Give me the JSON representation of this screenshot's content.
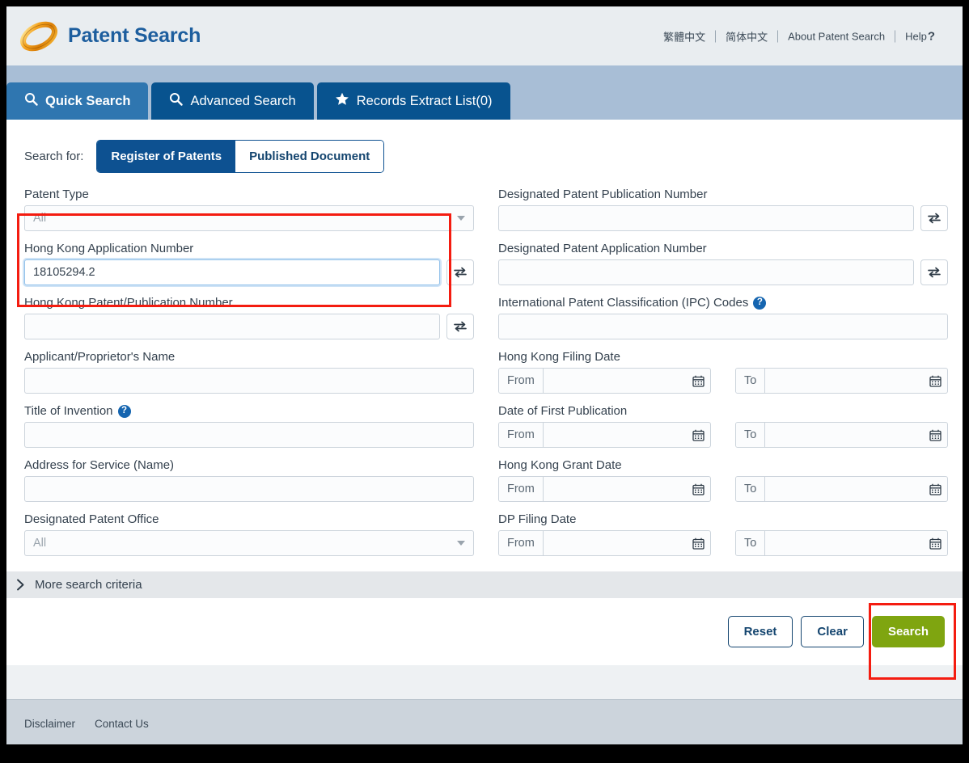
{
  "header": {
    "brand": "Patent Search",
    "logo_icon": "patent-ring-logo",
    "links": [
      {
        "label": "繁體中文",
        "name": "lang-traditional-chinese"
      },
      {
        "label": "简体中文",
        "name": "lang-simplified-chinese"
      },
      {
        "label": "About Patent Search",
        "name": "about-patent-search"
      },
      {
        "label": "Help",
        "name": "help"
      }
    ],
    "help_suffix": "?"
  },
  "tabs": [
    {
      "label": "Quick Search",
      "icon": "magnifier-icon",
      "active": true
    },
    {
      "label": "Advanced Search",
      "icon": "magnifier-icon",
      "active": false
    },
    {
      "label": "Records Extract List(0)",
      "icon": "star-icon",
      "active": false
    }
  ],
  "search_for": {
    "label": "Search for:",
    "options": [
      {
        "label": "Register of Patents",
        "selected": true
      },
      {
        "label": "Published Document",
        "selected": false
      }
    ]
  },
  "left_column": {
    "patent_type": {
      "label": "Patent Type",
      "value": "All",
      "placeholder": "All"
    },
    "hk_application_number": {
      "label": "Hong Kong Application Number",
      "value": "18105294.2",
      "placeholder": "",
      "swap_icon": "swap-arrows-icon",
      "highlighted": true
    },
    "hk_patent_publication_number": {
      "label": "Hong Kong Patent/Publication Number",
      "value": "",
      "placeholder": "",
      "swap_icon": "swap-arrows-icon"
    },
    "applicant_name": {
      "label": "Applicant/Proprietor's Name",
      "value": "",
      "placeholder": ""
    },
    "title_of_invention": {
      "label": "Title of Invention",
      "value": "",
      "placeholder": "",
      "help_icon": "question-mark-icon"
    },
    "address_for_service": {
      "label": "Address for Service (Name)",
      "value": "",
      "placeholder": ""
    },
    "designated_patent_office": {
      "label": "Designated Patent Office",
      "value": "All",
      "placeholder": "All"
    }
  },
  "right_column": {
    "dp_publication_number": {
      "label": "Designated Patent Publication Number",
      "value": "",
      "placeholder": "",
      "swap_icon": "swap-arrows-icon"
    },
    "dp_application_number": {
      "label": "Designated Patent Application Number",
      "value": "",
      "placeholder": "",
      "swap_icon": "swap-arrows-icon"
    },
    "ipc_codes": {
      "label": "International Patent Classification (IPC) Codes",
      "value": "",
      "placeholder": "",
      "help_icon": "question-mark-icon"
    },
    "date_ranges": [
      {
        "label": "Hong Kong Filing Date",
        "from_label": "From",
        "from_value": "",
        "to_label": "To",
        "to_value": "",
        "calendar_icon": "calendar-icon"
      },
      {
        "label": "Date of First Publication",
        "from_label": "From",
        "from_value": "",
        "to_label": "To",
        "to_value": "",
        "calendar_icon": "calendar-icon"
      },
      {
        "label": "Hong Kong Grant Date",
        "from_label": "From",
        "from_value": "",
        "to_label": "To",
        "to_value": "",
        "calendar_icon": "calendar-icon"
      },
      {
        "label": "DP Filing Date",
        "from_label": "From",
        "from_value": "",
        "to_label": "To",
        "to_value": "",
        "calendar_icon": "calendar-icon"
      }
    ]
  },
  "more_criteria": {
    "label": "More search criteria",
    "icon": "chevron-right-icon"
  },
  "actions": {
    "reset": "Reset",
    "clear": "Clear",
    "search": "Search"
  },
  "footer": {
    "links": [
      {
        "label": "Disclaimer"
      },
      {
        "label": "Contact Us"
      }
    ]
  },
  "colors": {
    "brand_blue": "#1d5e9e",
    "tab_active": "#2f76b0",
    "tab_idle": "#08538f",
    "tabbar_bg": "#a8bed6",
    "seg_on": "#0d5191",
    "search_green": "#7fa510",
    "annotation_red": "#f41c10",
    "footer_bg": "#ccd4dc"
  }
}
